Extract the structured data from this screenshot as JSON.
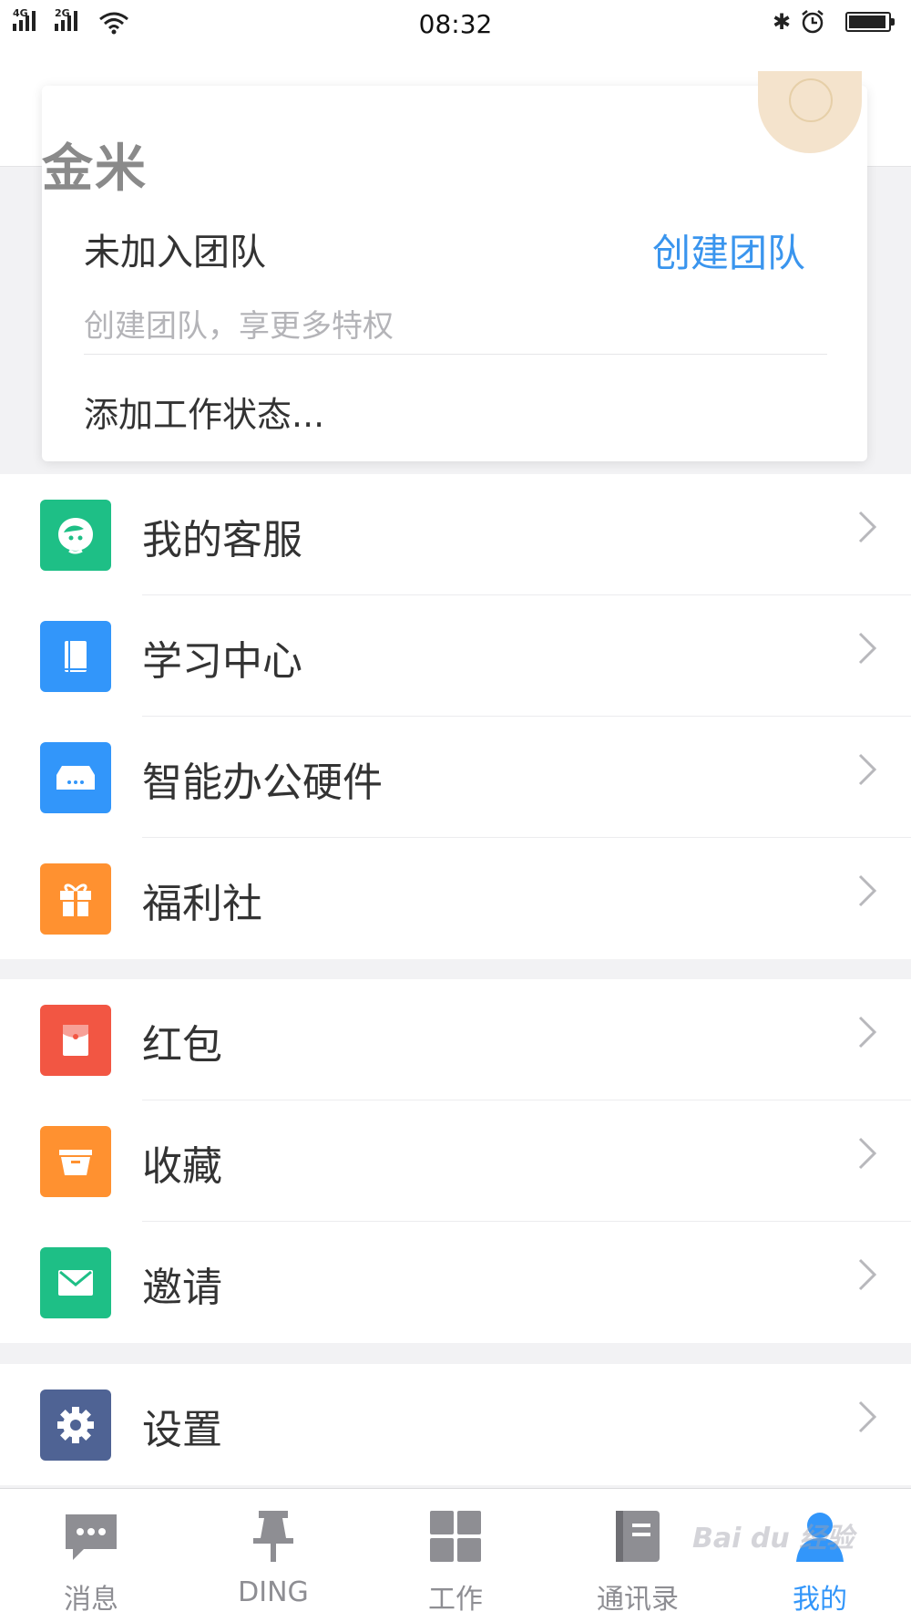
{
  "status_bar": {
    "time": "08:32",
    "signal_1": "4G",
    "signal_2": "2G",
    "battery_level": 0.95
  },
  "profile": {
    "name": "金米",
    "team_status": "未加入团队",
    "create_team_label": "创建团队",
    "team_hint": "创建团队，享更多特权",
    "work_status_placeholder": "添加工作状态..."
  },
  "menu_sections": [
    [
      {
        "label": "我的客服",
        "icon": "customer-service-icon",
        "color": "#1ebf86"
      },
      {
        "label": "学习中心",
        "icon": "book-icon",
        "color": "#3296fa"
      },
      {
        "label": "智能办公硬件",
        "icon": "hardware-icon",
        "color": "#3296fa"
      },
      {
        "label": "福利社",
        "icon": "gift-icon",
        "color": "#ff9130"
      }
    ],
    [
      {
        "label": "红包",
        "icon": "red-envelope-icon",
        "color": "#f25643"
      },
      {
        "label": "收藏",
        "icon": "favorites-icon",
        "color": "#ff9130"
      },
      {
        "label": "邀请",
        "icon": "mail-icon",
        "color": "#1ebf86"
      }
    ],
    [
      {
        "label": "设置",
        "icon": "gear-icon",
        "color": "#4f6394"
      }
    ]
  ],
  "tab_bar": [
    {
      "label": "消息",
      "icon": "message-icon"
    },
    {
      "label": "DING",
      "icon": "pin-icon"
    },
    {
      "label": "工作",
      "icon": "grid-icon"
    },
    {
      "label": "通讯录",
      "icon": "contacts-icon"
    },
    {
      "label": "我的",
      "icon": "person-icon",
      "active": true
    }
  ],
  "watermark": "Bai du 经验"
}
